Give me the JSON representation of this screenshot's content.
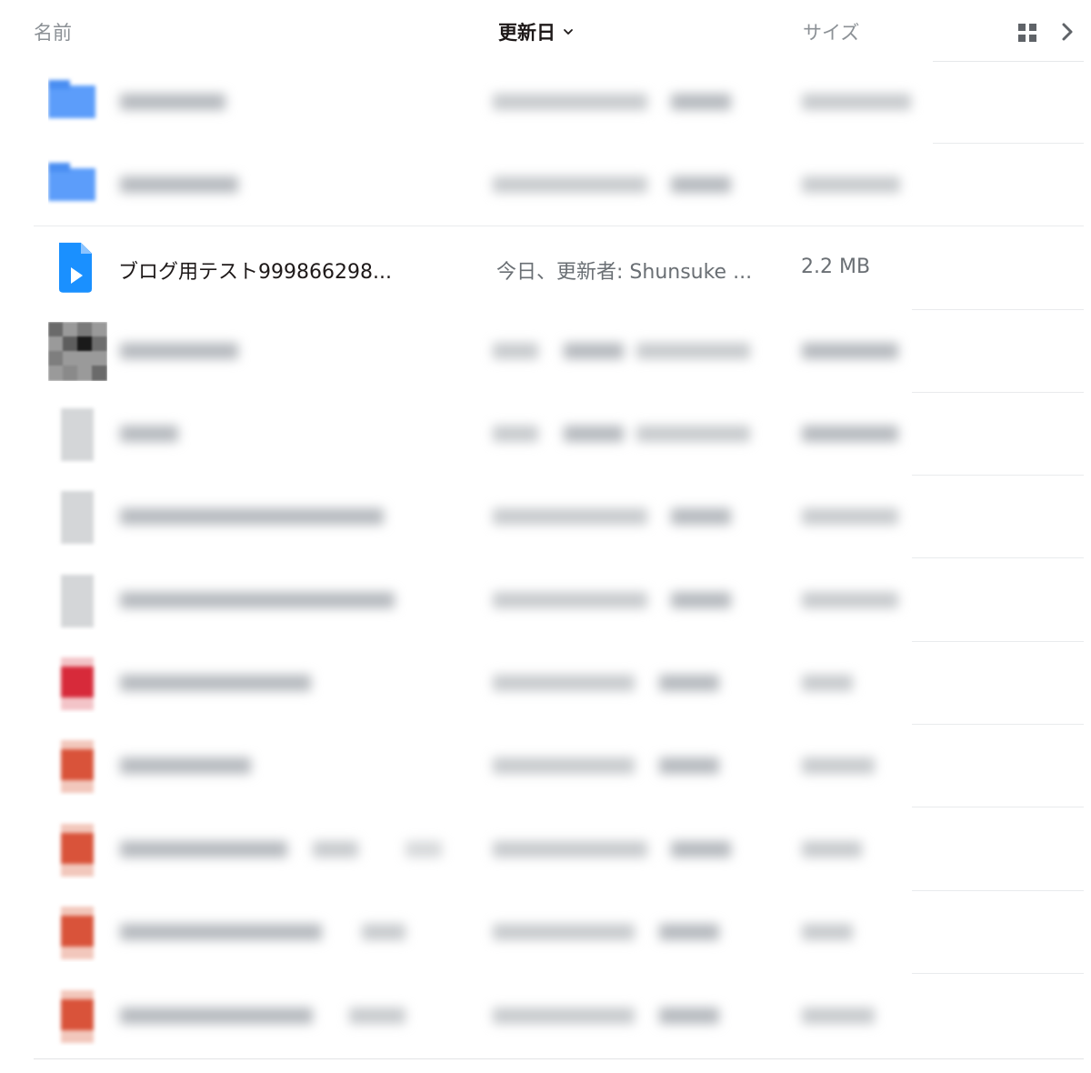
{
  "header": {
    "name_label": "名前",
    "date_label": "更新日",
    "size_label": "サイズ"
  },
  "icons": {
    "sort": "chevron-down-icon",
    "grid": "grid-view-icon",
    "next": "chevron-right-icon"
  },
  "colors": {
    "folder": "#5c9dfa",
    "video": "#1a90ff",
    "pdf": "#d72a3a",
    "pptx": "#d9533a"
  },
  "rows": [
    {
      "type": "folder"
    },
    {
      "type": "folder"
    },
    {
      "type": "video",
      "name": "ブログ用テスト999866298...",
      "modified": "今日、更新者: Shunsuke ...",
      "size": "2.2 MB"
    },
    {
      "type": "image"
    },
    {
      "type": "file"
    },
    {
      "type": "file"
    },
    {
      "type": "file"
    },
    {
      "type": "pdf"
    },
    {
      "type": "pptx"
    },
    {
      "type": "pptx"
    },
    {
      "type": "pptx"
    },
    {
      "type": "pptx"
    }
  ]
}
